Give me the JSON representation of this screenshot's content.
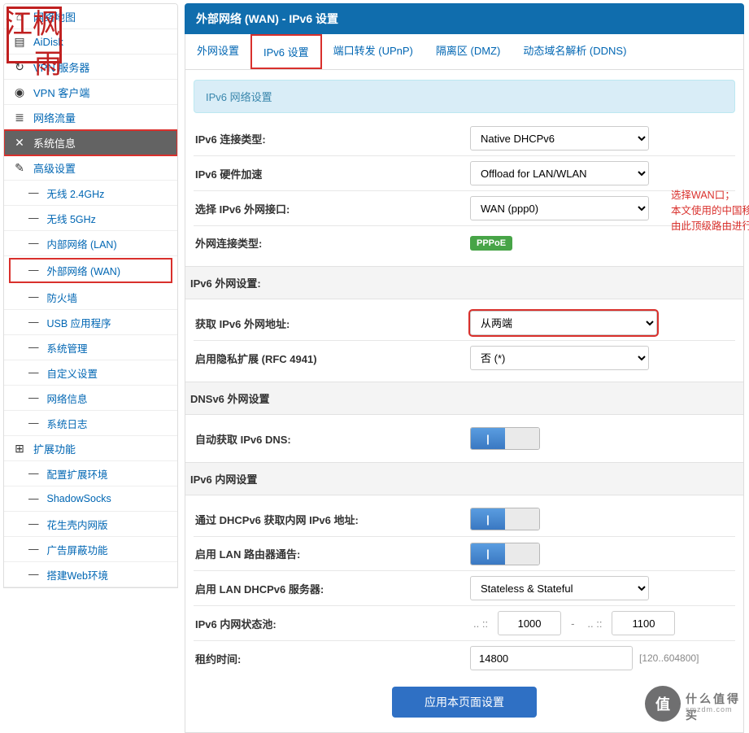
{
  "watermark1_a": "江枫",
  "watermark1_b": "雨",
  "sidebar": {
    "top": [
      {
        "icon": "⌂",
        "label": "网络地图"
      },
      {
        "icon": "▤",
        "label": "AiDisk"
      },
      {
        "icon": "↻",
        "label": "VPN 服务器"
      },
      {
        "icon": "◉",
        "label": "VPN 客户端"
      },
      {
        "icon": "≣",
        "label": "网络流量"
      }
    ],
    "sysinfo": {
      "icon": "✕",
      "label": "系统信息"
    },
    "advanced": {
      "icon": "✎",
      "label": "高级设置"
    },
    "adv_items": [
      "无线 2.4GHz",
      "无线 5GHz",
      "内部网络 (LAN)",
      "外部网络 (WAN)",
      "防火墙",
      "USB 应用程序",
      "系统管理",
      "自定义设置",
      "网络信息",
      "系统日志"
    ],
    "ext": {
      "icon": "⊞",
      "label": "扩展功能"
    },
    "ext_items": [
      "配置扩展环境",
      "ShadowSocks",
      "花生壳内网版",
      "广告屏蔽功能",
      "搭建Web环境"
    ]
  },
  "title": "外部网络 (WAN) - IPv6 设置",
  "tabs": [
    "外网设置",
    "IPv6 设置",
    "端口转发 (UPnP)",
    "隔离区 (DMZ)",
    "动态域名解析 (DDNS)"
  ],
  "infobox": "IPv6 网络设置",
  "rows": {
    "conn_type_lbl": "IPv6 连接类型:",
    "conn_type_val": "Native DHCPv6",
    "hw_lbl": "IPv6 硬件加速",
    "hw_val": "Offload for LAN/WLAN",
    "wan_if_lbl": "选择 IPv6 外网接口:",
    "wan_if_val": "WAN (ppp0)",
    "wan_conn_lbl": "外网连接类型:",
    "pppoe": "PPPoE",
    "section_wan": "IPv6 外网设置:",
    "get_addr_lbl": "获取 IPv6 外网地址:",
    "get_addr_val": "从两端",
    "privacy_lbl": "启用隐私扩展 (RFC 4941)",
    "privacy_val": "否 (*)",
    "section_dns": "DNSv6 外网设置",
    "auto_dns_lbl": "自动获取 IPv6 DNS:",
    "section_lan": "IPv6 内网设置",
    "dhcp_lan_lbl": "通过 DHCPv6 获取内网 IPv6 地址:",
    "lan_ra_lbl": "启用 LAN 路由器通告:",
    "lan_dhcp_lbl": "启用 LAN DHCPv6 服务器:",
    "lan_dhcp_val": "Stateless & Stateful",
    "pool_lbl": "IPv6 内网状态池:",
    "pool_a": "1000",
    "pool_sep": "-",
    "pool_b": "1100",
    "lease_lbl": "租约时间:",
    "lease_val": "14800",
    "lease_hint": "[120..604800]"
  },
  "sidenote": {
    "l1": "选择WAN口；",
    "l2": "本文使用的中国移动光猫不拨号，",
    "l3": "由此顶级路由进行拨号"
  },
  "apply": "应用本页面设置",
  "wm2a": "值",
  "wm2b": "什么值得买",
  "wm2c": "smzdm.com"
}
